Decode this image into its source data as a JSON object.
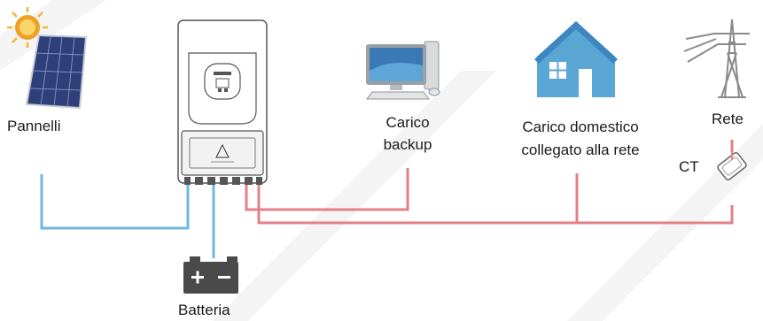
{
  "labels": {
    "panels": "Pannelli",
    "backup_load_line1": "Carico",
    "backup_load_line2": "backup",
    "home_load_line1": "Carico domestico",
    "home_load_line2": "collegato alla rete",
    "grid": "Rete",
    "ct": "CT",
    "battery": "Batteria"
  },
  "colors": {
    "dc_line": "#6fb7e0",
    "ac_line": "#e57f87",
    "house": "#5aa7d6",
    "battery": "#4a4a4a",
    "inverter_outline": "#555555"
  },
  "icons": [
    "solar-panel-icon",
    "sun-icon",
    "inverter-icon",
    "computer-icon",
    "house-icon",
    "grid-tower-icon",
    "ct-clamp-icon",
    "battery-icon"
  ]
}
